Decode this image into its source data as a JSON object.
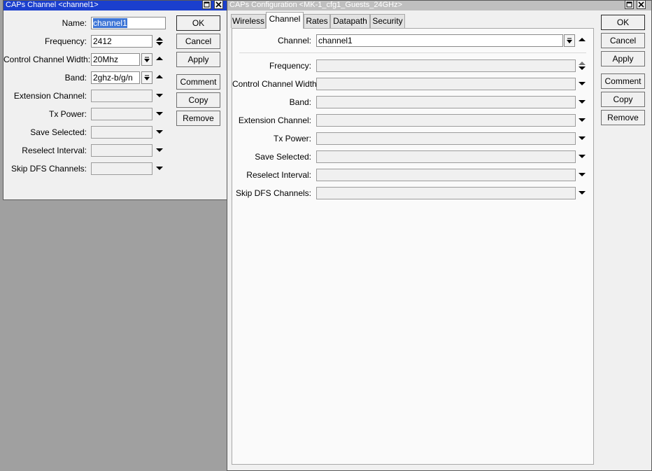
{
  "left_window": {
    "title": "CAPs Channel <channel1>",
    "fields": {
      "name": {
        "label": "Name:",
        "value": "channel1"
      },
      "frequency": {
        "label": "Frequency:",
        "value": "2412"
      },
      "control_channel_width": {
        "label": "Control Channel Width:",
        "value": "20Mhz"
      },
      "band": {
        "label": "Band:",
        "value": "2ghz-b/g/n"
      },
      "extension_channel": {
        "label": "Extension Channel:",
        "value": ""
      },
      "tx_power": {
        "label": "Tx Power:",
        "value": ""
      },
      "save_selected": {
        "label": "Save Selected:",
        "value": ""
      },
      "reselect_interval": {
        "label": "Reselect Interval:",
        "value": ""
      },
      "skip_dfs_channels": {
        "label": "Skip DFS Channels:",
        "value": ""
      }
    },
    "buttons": {
      "ok": "OK",
      "cancel": "Cancel",
      "apply": "Apply",
      "comment": "Comment",
      "copy": "Copy",
      "remove": "Remove"
    }
  },
  "right_window": {
    "title": "CAPs Configuration <MK-1_cfg1_Guests_24GHz>",
    "tabs": [
      {
        "label": "Wireless"
      },
      {
        "label": "Channel",
        "active": true
      },
      {
        "label": "Rates"
      },
      {
        "label": "Datapath"
      },
      {
        "label": "Security"
      }
    ],
    "fields": {
      "channel": {
        "label": "Channel:",
        "value": "channel1"
      },
      "frequency": {
        "label": "Frequency:",
        "value": ""
      },
      "control_channel_width": {
        "label": "Control Channel Width:",
        "value": ""
      },
      "band": {
        "label": "Band:",
        "value": ""
      },
      "extension_channel": {
        "label": "Extension Channel:",
        "value": ""
      },
      "tx_power": {
        "label": "Tx Power:",
        "value": ""
      },
      "save_selected": {
        "label": "Save Selected:",
        "value": ""
      },
      "reselect_interval": {
        "label": "Reselect Interval:",
        "value": ""
      },
      "skip_dfs_channels": {
        "label": "Skip DFS Channels:",
        "value": ""
      }
    },
    "buttons": {
      "ok": "OK",
      "cancel": "Cancel",
      "apply": "Apply",
      "comment": "Comment",
      "copy": "Copy",
      "remove": "Remove"
    }
  },
  "colors": {
    "active_title": "#1b3fce",
    "inactive_title": "#bfbfbf",
    "desktop": "#a0a0a0",
    "selection": "#3d75d6"
  },
  "icons": [
    "maximize-icon",
    "close-icon",
    "dropdown-icon",
    "collapse-up-icon",
    "expand-down-icon",
    "spinner-icon"
  ]
}
